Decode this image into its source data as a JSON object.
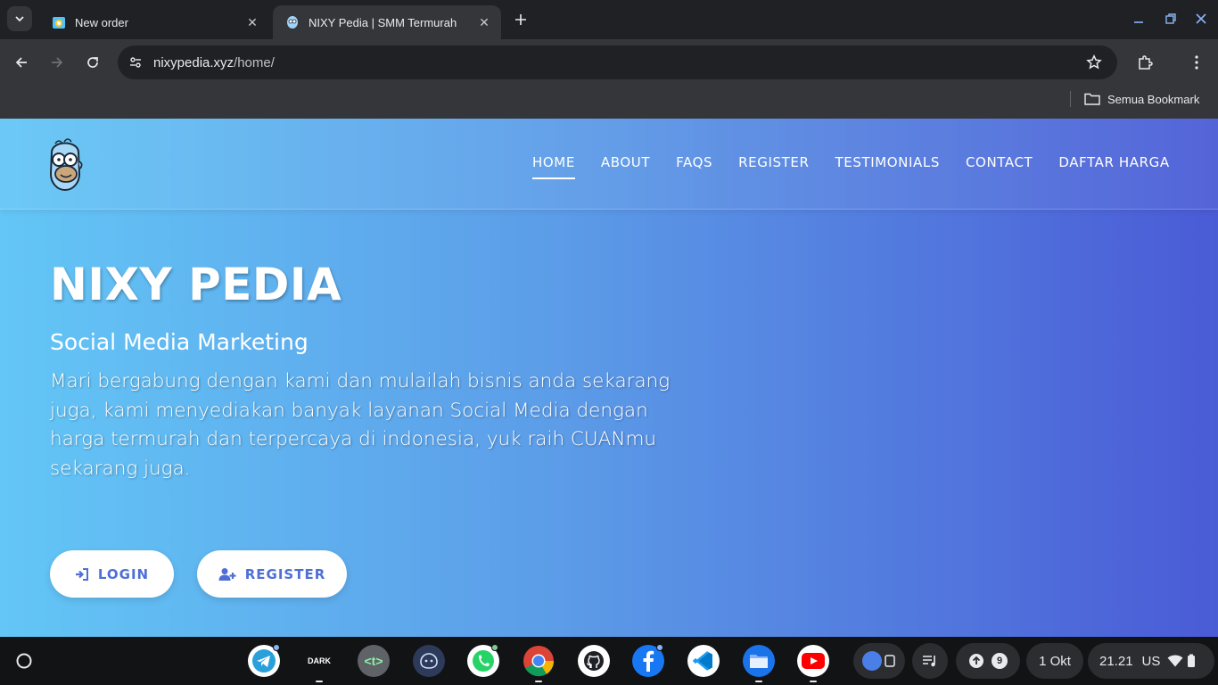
{
  "browser": {
    "tabs": [
      {
        "title": "New order",
        "icon": "site-favicon",
        "active": false
      },
      {
        "title": "NIXY Pedia | SMM Termurah",
        "icon": "homer-favicon",
        "active": true
      }
    ],
    "url_host": "nixypedia.xyz",
    "url_path": "/home/",
    "bookmarks_label": "Semua Bookmark"
  },
  "site": {
    "nav": [
      "HOME",
      "ABOUT",
      "FAQS",
      "REGISTER",
      "TESTIMONIALS",
      "CONTACT",
      "DAFTAR HARGA"
    ],
    "active_nav": "HOME",
    "hero": {
      "title": "NIXY PEDIA",
      "subtitle": "Social Media Marketing",
      "lines": [
        "Mari bergabung dengan kami dan mulailah bisnis anda sekarang",
        "juga, kami menyediakan banyak layanan Social Media dengan",
        "harga termurah dan terpercaya di indonesia, yuk raih CUANmu",
        "sekarang juga."
      ]
    },
    "buttons": {
      "login": "LOGIN",
      "register": "REGISTER"
    },
    "colors": {
      "gradient_start": "#63c6f6",
      "gradient_end": "#4a5bd6",
      "button_text": "#4f6fd6"
    }
  },
  "shelf": {
    "apps": [
      "telegram-icon",
      "dark-app-icon",
      "terminal-app-icon",
      "app-icon",
      "whatsapp-icon",
      "chrome-icon",
      "github-icon",
      "facebook-icon",
      "vscode-icon",
      "files-icon",
      "youtube-icon"
    ],
    "dark_label": "DARK",
    "terminal_label": "<t>",
    "notification_count": "9",
    "date": "1 Okt",
    "time": "21.21",
    "keyboard": "US"
  }
}
